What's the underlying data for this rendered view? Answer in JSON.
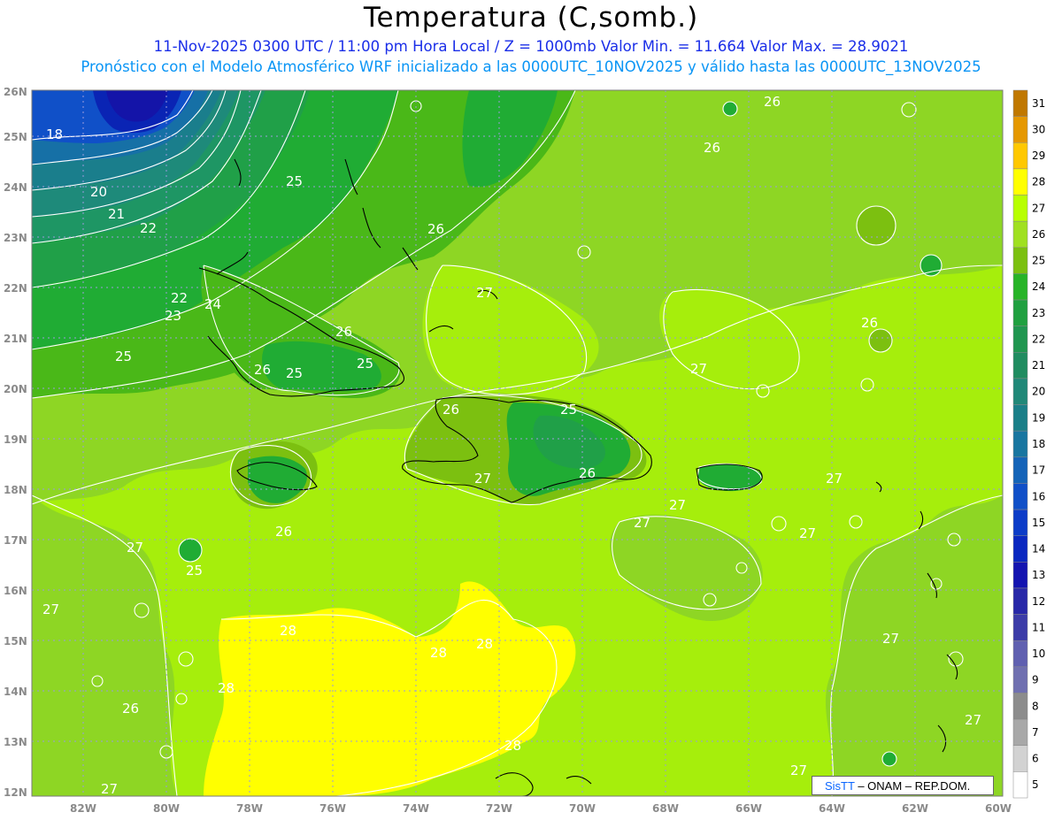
{
  "header": {
    "title": "Temperatura (C,somb.)",
    "subtitle_line1": "11-Nov-2025 0300 UTC / 11:00 pm Hora Local / Z = 1000mb   Valor Min. = 11.664  Valor Max. = 28.9021",
    "subtitle_line2": "Pronóstico con el Modelo Atmosférico WRF inicializado a las 0000UTC_10NOV2025 y válido hasta las  0000UTC_13NOV2025"
  },
  "map_data": {
    "type": "filled-contour",
    "variable": "Temperatura",
    "units": "C",
    "level": "1000mb",
    "lon_range": [
      -83,
      -60
    ],
    "lat_range": [
      12,
      26
    ],
    "value_min": 11.664,
    "value_max": 28.9021,
    "x_ticks": [
      "82W",
      "80W",
      "78W",
      "76W",
      "74W",
      "72W",
      "70W",
      "68W",
      "66W",
      "64W",
      "62W",
      "60W"
    ],
    "y_ticks": [
      "12N",
      "13N",
      "14N",
      "15N",
      "16N",
      "17N",
      "18N",
      "19N",
      "20N",
      "21N",
      "22N",
      "23N",
      "24N",
      "25N",
      "26N"
    ],
    "grid": true,
    "contour_labels": [
      "18",
      "20",
      "21",
      "22",
      "22",
      "23",
      "24",
      "25",
      "25",
      "25",
      "26",
      "26",
      "26",
      "26",
      "26",
      "26",
      "26",
      "26",
      "25",
      "25",
      "25",
      "27",
      "27",
      "27",
      "27",
      "27",
      "27",
      "27",
      "27",
      "27",
      "27",
      "27",
      "27",
      "27",
      "28",
      "28",
      "28",
      "28",
      "28",
      "26",
      "26"
    ]
  },
  "colorbar": {
    "levels": [
      "31",
      "30",
      "29",
      "28",
      "27",
      "26",
      "25",
      "24",
      "23",
      "22",
      "21",
      "20",
      "19",
      "18",
      "17",
      "16",
      "15",
      "14",
      "13",
      "12",
      "11",
      "10",
      "9",
      "8",
      "7",
      "6",
      "5"
    ],
    "colors": [
      "#c07800",
      "#e59800",
      "#ffc800",
      "#ffff00",
      "#b8ff00",
      "#a0e020",
      "#7cc010",
      "#28b428",
      "#20a040",
      "#209650",
      "#208c60",
      "#208878",
      "#1a7f88",
      "#1876a0",
      "#1464b8",
      "#1050c8",
      "#0c3cc8",
      "#0a28c0",
      "#1414b0",
      "#2828a8",
      "#3c3ca8",
      "#6060b0",
      "#7070b0",
      "#8c8c8c",
      "#a8a8a8",
      "#d2d2d2",
      "#ffffff"
    ]
  },
  "credit": {
    "brand": "SisTT",
    "rest": "– ONAM – REP.DOM."
  }
}
